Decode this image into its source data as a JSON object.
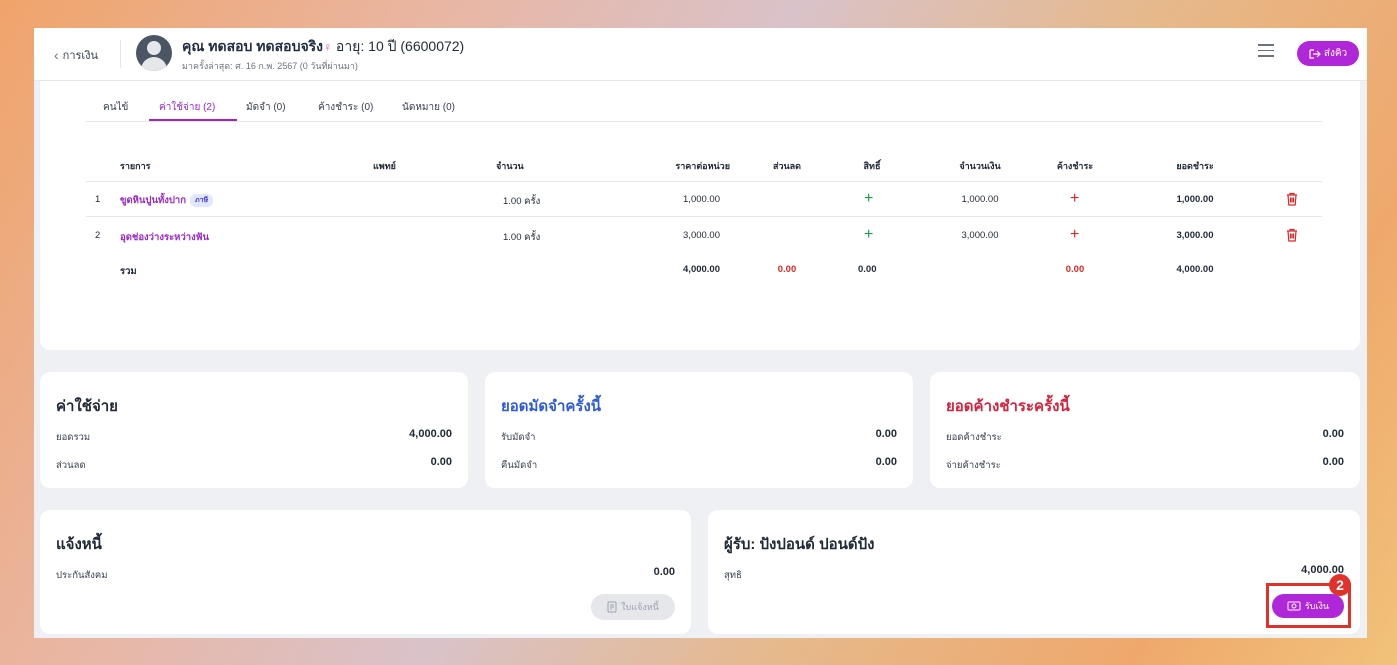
{
  "header": {
    "back_label": "การเงิน",
    "patient_name": "คุณ ทดสอบ ทดสอบจริง",
    "gender_symbol": "♀",
    "age_text": "อายุ: 10 ปี (6600072)",
    "last_visit": "มาครั้งล่าสุด: ศ. 16 ก.พ. 2567 (0 วันที่ผ่านมา)",
    "queue_button": "ส่งคิว"
  },
  "tabs": [
    {
      "label": "คนไข้",
      "active": false
    },
    {
      "label": "ค่าใช้จ่าย (2)",
      "active": true
    },
    {
      "label": "มัดจำ (0)",
      "active": false
    },
    {
      "label": "ค้างชำระ (0)",
      "active": false
    },
    {
      "label": "นัดหมาย (0)",
      "active": false
    }
  ],
  "table": {
    "headers": {
      "item": "รายการ",
      "doctor": "แพทย์",
      "qty": "จำนวน",
      "unit_price": "ราคาต่อหน่วย",
      "discount": "ส่วนลด",
      "rights": "สิทธิ์",
      "amount": "จำนวนเงิน",
      "outstanding": "ค้างชำระ",
      "payable": "ยอดชำระ"
    },
    "rows": [
      {
        "no": "1",
        "item": "ขูดหินปูนทั้งปาก",
        "tag": "ภาษี",
        "qty": "1.00  ครั้ง",
        "unit_price": "1,000.00",
        "amount": "1,000.00",
        "payable": "1,000.00"
      },
      {
        "no": "2",
        "item": "อุดช่องว่างระหว่างฟัน",
        "tag": "",
        "qty": "1.00  ครั้ง",
        "unit_price": "3,000.00",
        "amount": "3,000.00",
        "payable": "3,000.00"
      }
    ],
    "total": {
      "label": "รวม",
      "unit_price": "4,000.00",
      "discount": "0.00",
      "rights": "0.00",
      "outstanding": "0.00",
      "payable": "4,000.00"
    }
  },
  "expenses": {
    "title": "ค่าใช้จ่าย",
    "total_label": "ยอดรวม",
    "total": "4,000.00",
    "discount_label": "ส่วนลด",
    "discount": "0.00"
  },
  "deposit": {
    "title": "ยอดมัดจำครั้งนี้",
    "receive_label": "รับมัดจำ",
    "receive": "0.00",
    "refund_label": "คืนมัดจำ",
    "refund": "0.00"
  },
  "outstanding": {
    "title": "ยอดค้างชำระครั้งนี้",
    "due_label": "ยอดค้างชำระ",
    "due": "0.00",
    "paid_label": "จ่ายค้างชำระ",
    "paid": "0.00"
  },
  "debt": {
    "title": "แจ้งหนี้",
    "sso_label": "ประกันสังคม",
    "sso": "0.00",
    "invoice_button": "ใบแจ้งหนี้"
  },
  "payment": {
    "title": "ผู้รับ: ปังปอนด์ ปอนด์ปัง",
    "net_label": "สุทธิ",
    "net": "4,000.00",
    "receive_button": "รับเงิน"
  },
  "annotation": {
    "step": "2"
  },
  "colors": {
    "accent": "#b026d9",
    "blue_title": "#2f5bd7",
    "red_title": "#d4213d",
    "highlight": "#e0322a"
  }
}
